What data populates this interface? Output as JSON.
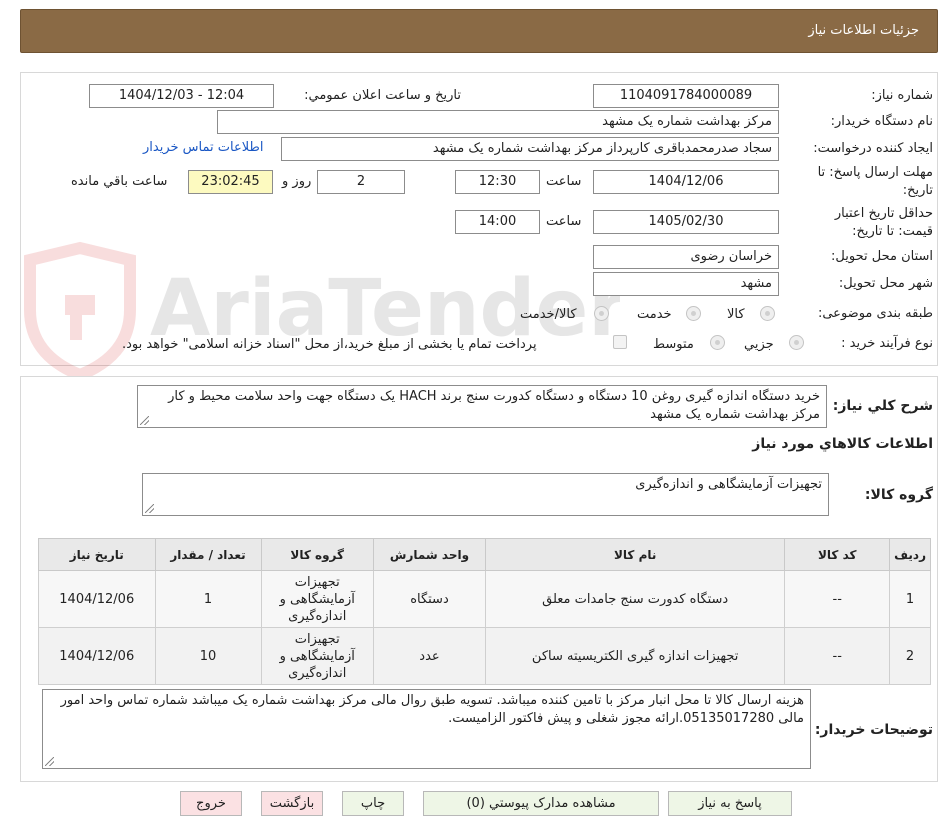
{
  "header": {
    "title": "جزئیات اطلاعات نیاز"
  },
  "watermark": {
    "text": "AriaTender.net"
  },
  "form": {
    "need_number_label": "شماره نیاز:",
    "need_number": "1104091784000089",
    "announce_label": "تاریخ و ساعت اعلان عمومي:",
    "announce_value": "1404/12/03 - 12:04",
    "buyer_label": "نام دستگاه خریدار:",
    "buyer_value": "مرکز بهداشت شماره یک مشهد",
    "creator_label": "ایجاد کننده درخواست:",
    "creator_value": "سجاد صدرمحمدباقری کارپرداز مرکز بهداشت شماره یک مشهد",
    "contact_link": "اطلاعات تماس خریدار",
    "deadline_label": "مهلت ارسال پاسخ: تا تاریخ:",
    "deadline_date": "1404/12/06",
    "time_label": "ساعت",
    "deadline_time": "12:30",
    "days_value": "2",
    "days_label": "روز و",
    "remaining_value": "23:02:45",
    "remaining_label": "ساعت باقي مانده",
    "validity_label": "حداقل تاریخ اعتبار قیمت: تا تاریخ:",
    "validity_date": "1405/02/30",
    "validity_time": "14:00",
    "province_label": "استان محل تحویل:",
    "province_value": "خراسان رضوی",
    "city_label": "شهر محل تحویل:",
    "city_value": "مشهد",
    "category_label": "طبقه بندی موضوعی:",
    "category_options": [
      "کالا",
      "خدمت",
      "کالا/خدمت"
    ],
    "process_label": "نوع فرآیند خرید :",
    "process_options": [
      "جزيي",
      "متوسط"
    ],
    "process_note": "پرداخت تمام یا بخشی از مبلغ خرید،از محل \"اسناد خزانه اسلامی\" خواهد بود."
  },
  "summary": {
    "label": "شرح كلي نياز:",
    "text": "خرید دستگاه اندازه گیری روغن 10 دستگاه و دستگاه کدورت سنج  برند HACH یک دستگاه جهت واحد سلامت محیط و کار مرکز بهداشت شماره یک مشهد"
  },
  "goods": {
    "section_title": "اطلاعات کالاهاي مورد نياز",
    "group_label": "گروه کالا:",
    "group_value": "تجهیزات آزمایشگاهی و اندازه‌گیری",
    "table": {
      "headers": [
        "رديف",
        "کد کالا",
        "نام کالا",
        "واحد شمارش",
        "گروه کالا",
        "تعداد / مقدار",
        "تاریخ نیاز"
      ],
      "rows": [
        [
          "1",
          "--",
          "دستگاه کدورت سنج جامدات معلق",
          "دستگاه",
          "تجهیزات آزمایشگاهی و اندازه‌گیری",
          "1",
          "1404/12/06"
        ],
        [
          "2",
          "--",
          "تجهیزات اندازه گیری الکتریسیته ساکن",
          "عدد",
          "تجهیزات آزمایشگاهی و اندازه‌گیری",
          "10",
          "1404/12/06"
        ]
      ]
    }
  },
  "notes": {
    "label": "توضیحات خریدار:",
    "text": "هزینه ارسال کالا تا محل انبار مرکز با تامین کننده میباشد. تسویه طبق روال مالی مرکز بهداشت شماره یک میباشد شماره تماس واحد امور مالی 05135017280.ارائه مجوز شغلی و پیش فاکتور الزامیست."
  },
  "buttons": {
    "reply": "پاسخ به نیاز",
    "attachments": "مشاهده مدارک پیوستي (0)",
    "print": "چاپ",
    "back": "بازگشت",
    "exit": "خروج"
  }
}
